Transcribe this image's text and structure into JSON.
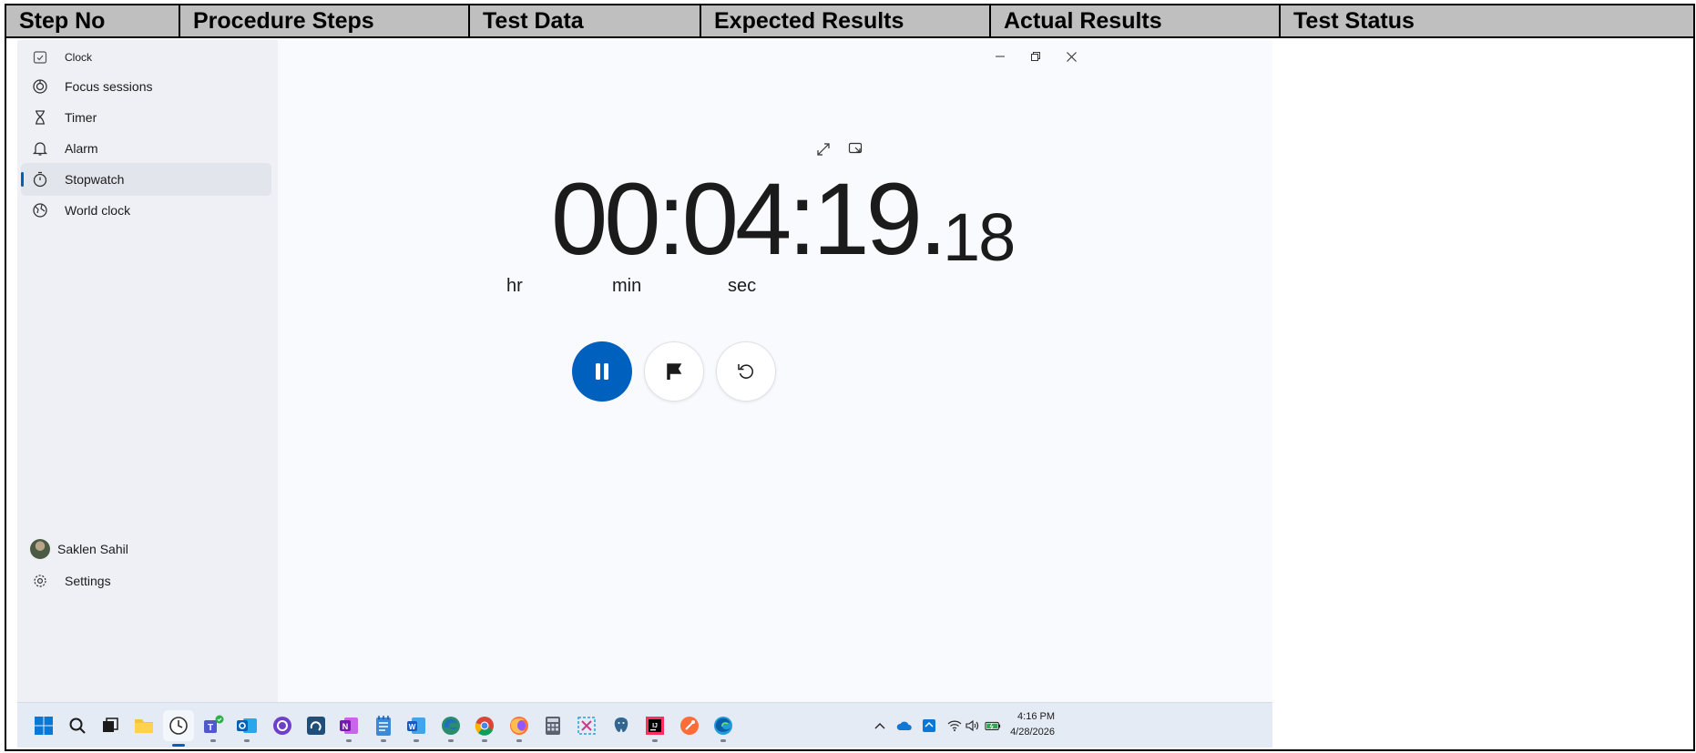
{
  "table": {
    "headers": [
      "Step No",
      "Procedure Steps",
      "Test Data",
      "Expected Results",
      "Actual Results",
      "Test Status"
    ]
  },
  "app": {
    "title": "Clock",
    "nav": [
      {
        "label": "Focus sessions",
        "icon": "focus-icon"
      },
      {
        "label": "Timer",
        "icon": "hourglass-icon"
      },
      {
        "label": "Alarm",
        "icon": "bell-icon"
      },
      {
        "label": "Stopwatch",
        "icon": "stopwatch-icon",
        "active": true
      },
      {
        "label": "World clock",
        "icon": "globe-icon"
      }
    ],
    "user": {
      "name": "Saklen Sahil"
    },
    "settings_label": "Settings"
  },
  "stopwatch": {
    "time_main": "00:04:19.",
    "time_fraction": "18",
    "units": {
      "hr": "hr",
      "min": "min",
      "sec": "sec"
    }
  },
  "taskbar": {
    "time": "4:16 PM",
    "date": "4/28/2026"
  },
  "colors": {
    "accent": "#0060be",
    "header_bg": "#bfbfbf"
  }
}
